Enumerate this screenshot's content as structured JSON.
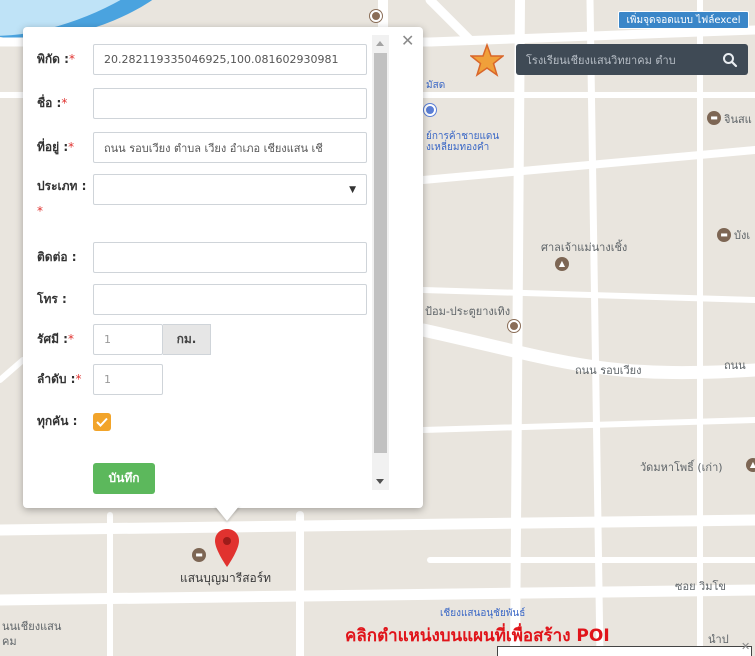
{
  "map": {
    "labels": [
      {
        "text": "มัสด"
      },
      {
        "text": "ย์การค้าชายแดน"
      },
      {
        "text": "งเหลี่ยมทองคำ"
      },
      {
        "text": "จินสแ"
      },
      {
        "text": "บังเ"
      },
      {
        "text": "ศาลเจ้าแม่นางเชิ้ง"
      },
      {
        "text": "ป้อม-ประตูยางเทิง"
      },
      {
        "text": "ถนน รอบเวียง"
      },
      {
        "text": "ถนน"
      },
      {
        "text": "วัดมหาโพธิ์ (เก่า)"
      },
      {
        "text": "แสนบุญมารีสอร์ท"
      },
      {
        "text": "ซอย วิมโข"
      },
      {
        "text": "นนเชียงแสน"
      },
      {
        "text": "คม"
      },
      {
        "text": "นำป"
      },
      {
        "text": "เชียงแสนอนุชัยพันธ์"
      }
    ]
  },
  "toolbar": {
    "excel_button_label": "เพิ่มจุดจอดแบบ ไฟล์excel"
  },
  "search": {
    "value": "โรงเรียนเชียงแสนวิทยาคม ตำบ"
  },
  "form": {
    "coords_label": "พิกัด :",
    "coords_value": "20.282119335046925,100.081602930981",
    "name_label": "ชื่อ :",
    "name_value": "",
    "address_label": "ที่อยู่ :",
    "address_value": "ถนน รอบเวียง ตำบล เวียง อำเภอ เชียงแสน เชี",
    "type_label": "ประเภท :",
    "type_value": "",
    "contact_label": "ติดต่อ :",
    "contact_value": "",
    "phone_label": "โทร :",
    "phone_value": "",
    "radius_label": "รัศมี :",
    "radius_value": "1",
    "radius_unit": "กม.",
    "order_label": "ลำดับ :",
    "order_value": "1",
    "everyone_label": "ทุกคัน :",
    "everyone_checked": true,
    "save_label": "บันทึก",
    "required_mark": "*"
  },
  "hint": {
    "text": "คลิกตำแหน่งบนแผนที่เพื่อสร้าง POI"
  },
  "colors": {
    "accent": "#3a86c8",
    "save": "#5cb85c",
    "checkbox": "#f2a42a",
    "hint": "#e0141a",
    "marker": "#e1322f"
  }
}
